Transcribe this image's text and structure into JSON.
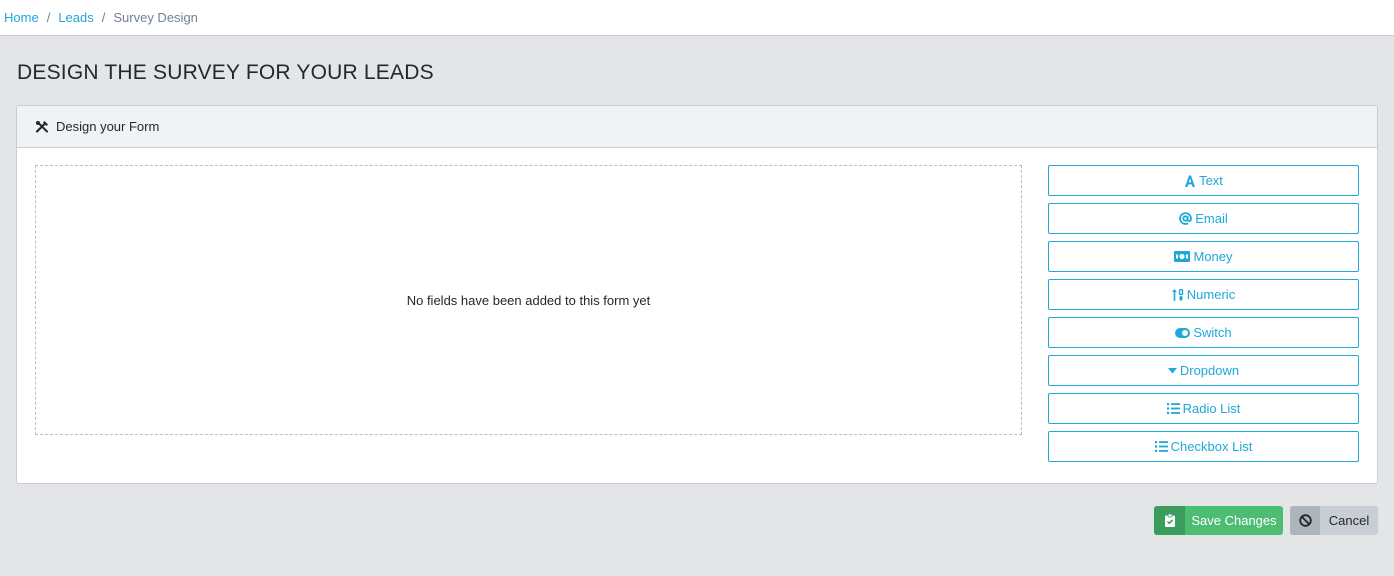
{
  "breadcrumb": {
    "items": [
      "Home",
      "Leads"
    ],
    "separator": "/",
    "current": "Survey Design"
  },
  "page": {
    "title": "DESIGN THE SURVEY FOR YOUR LEADS"
  },
  "card": {
    "header_icon": "tools-icon",
    "header": "Design your Form",
    "empty_message": "No fields have been added to this form yet"
  },
  "field_types": [
    {
      "label": "Text",
      "icon": "font-icon"
    },
    {
      "label": "Email",
      "icon": "at-icon"
    },
    {
      "label": "Money",
      "icon": "money-bill-icon"
    },
    {
      "label": "Numeric",
      "icon": "sort-numeric-icon"
    },
    {
      "label": "Switch",
      "icon": "toggle-icon"
    },
    {
      "label": "Dropdown",
      "icon": "caret-down-icon"
    },
    {
      "label": "Radio List",
      "icon": "list-icon"
    },
    {
      "label": "Checkbox List",
      "icon": "list-icon"
    }
  ],
  "actions": {
    "save": {
      "label": "Save Changes",
      "icon": "clipboard-check-icon"
    },
    "cancel": {
      "label": "Cancel",
      "icon": "ban-icon"
    }
  },
  "colors": {
    "accent": "#20a8d8",
    "success": "#4dbd74",
    "success_dark": "#3a9d5d",
    "secondary": "#c8ced3",
    "background": "#e4e5e7"
  }
}
